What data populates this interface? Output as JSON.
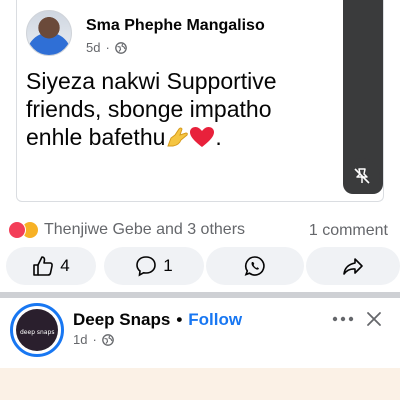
{
  "shared_post": {
    "author": "Sma Phephe Mangaliso",
    "time": "5d",
    "text_line1": "Siyeza nakwi Supportive",
    "text_line2": "friends, sbonge impatho",
    "text_line3": "enhle bafethu",
    "text_end": ".",
    "emojis": [
      "pinching-hand-emoji",
      "red-heart-emoji"
    ]
  },
  "reactions": {
    "icons": [
      "love-reaction-icon",
      "care-reaction-icon"
    ],
    "names": "Thenjiwe Gebe and 3 others",
    "comments": "1 comment"
  },
  "actions": {
    "like_count": "4",
    "comment_count": "1"
  },
  "next_post": {
    "page_name": "Deep Snaps",
    "separator": "•",
    "follow_label": "Follow",
    "time": "1d",
    "avatar_text": "deep snaps"
  },
  "colors": {
    "accent": "#1877f2",
    "secondary_text": "#65676b",
    "button_bg": "#f0f2f5",
    "love": "#f33e58",
    "care": "#f7b125"
  }
}
